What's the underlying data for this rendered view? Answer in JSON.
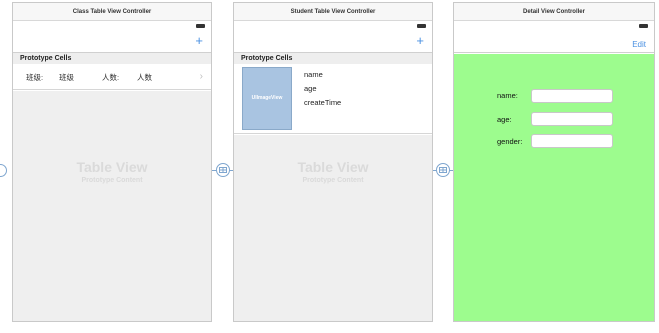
{
  "scenes": {
    "class": {
      "title": "Class Table View Controller",
      "add_button": "+",
      "section_header": "Prototype Cells",
      "cell": {
        "label1": "班级:",
        "value1": "班级",
        "label2": "人数:",
        "value2": "人数",
        "chevron": "›"
      },
      "table_title": "Table View",
      "table_subtitle": "Prototype Content"
    },
    "student": {
      "title": "Student Table View Controller",
      "add_button": "+",
      "section_header": "Prototype Cells",
      "cell": {
        "image_label": "UIImageView",
        "name": "name",
        "age": "age",
        "create_time": "createTime"
      },
      "table_title": "Table View",
      "table_subtitle": "Prototype Content"
    },
    "detail": {
      "title": "Detail View Controller",
      "edit_button": "Edit",
      "form": {
        "name_label": "name:",
        "age_label": "age:",
        "gender_label": "gender:"
      },
      "background_color": "#9dfc8e"
    }
  },
  "icons": {
    "battery": "battery-icon",
    "segue": "segue-icon"
  },
  "colors": {
    "accent": "#4a90e2",
    "segue": "#7fa6cf",
    "image_view": "#a9c4e1"
  }
}
